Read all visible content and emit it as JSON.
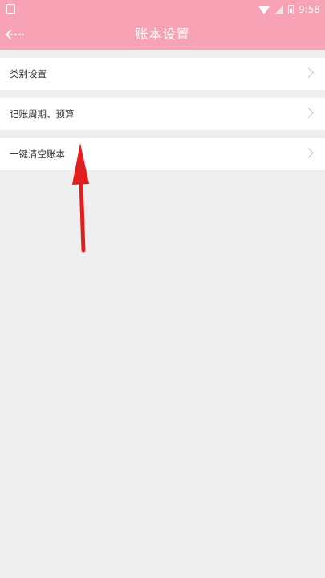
{
  "status_bar": {
    "time": "9:58",
    "icons": [
      "notification-icon",
      "wifi-icon",
      "signal-icon",
      "battery-icon"
    ]
  },
  "header": {
    "title": "账本设置",
    "back_icon": "back-arrow-icon"
  },
  "settings": [
    {
      "label": "类别设置"
    },
    {
      "label": "记账周期、预算"
    },
    {
      "label": "一键清空账本"
    }
  ],
  "colors": {
    "brand_pink": "#f7a3b5",
    "background": "#efefef",
    "annotation_red": "#e21d1d"
  }
}
